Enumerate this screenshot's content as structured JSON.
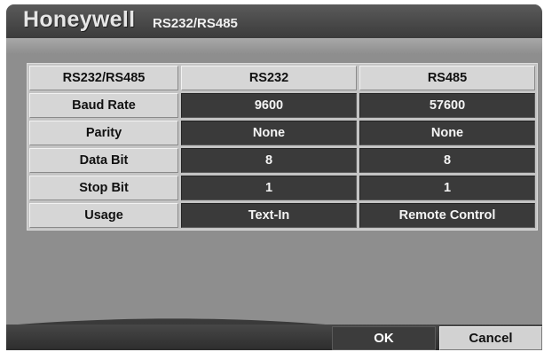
{
  "header": {
    "brand": "Honeywell",
    "title": "RS232/RS485"
  },
  "table": {
    "columns": [
      "RS232/RS485",
      "RS232",
      "RS485"
    ],
    "rows": [
      {
        "label": "Baud Rate",
        "rs232": "9600",
        "rs485": "57600"
      },
      {
        "label": "Parity",
        "rs232": "None",
        "rs485": "None"
      },
      {
        "label": "Data Bit",
        "rs232": "8",
        "rs485": "8"
      },
      {
        "label": "Stop Bit",
        "rs232": "1",
        "rs485": "1"
      },
      {
        "label": "Usage",
        "rs232": "Text-In",
        "rs485": "Remote Control"
      }
    ]
  },
  "footer": {
    "ok_label": "OK",
    "cancel_label": "Cancel"
  },
  "colors": {
    "panel": "#8e8e8e",
    "header_cell": "#d6d6d6",
    "value_cell": "#3a3a3a",
    "title_bar": "#3b3b3b"
  }
}
